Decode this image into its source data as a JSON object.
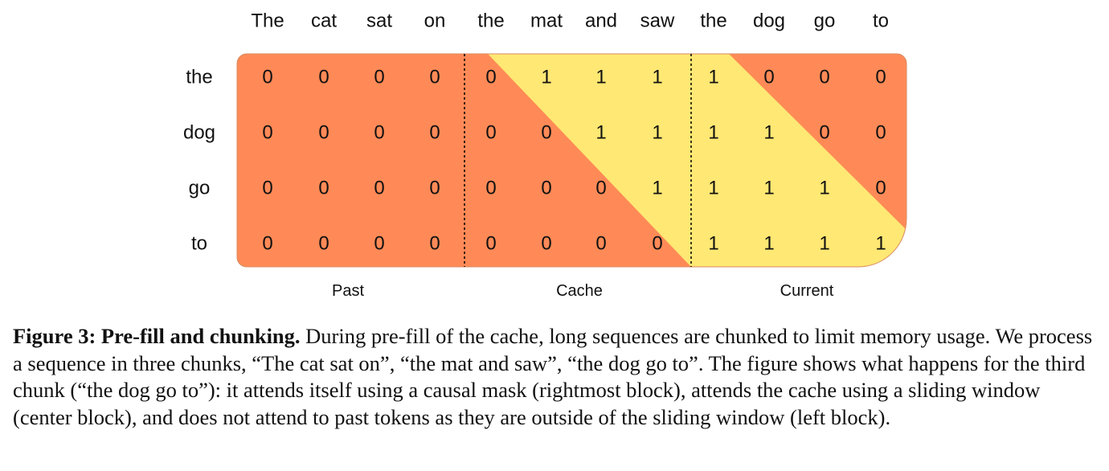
{
  "figure": {
    "columns": [
      "The",
      "cat",
      "sat",
      "on",
      "the",
      "mat",
      "and",
      "saw",
      "the",
      "dog",
      "go",
      "to"
    ],
    "rows": [
      {
        "label": "the",
        "values": [
          "0",
          "0",
          "0",
          "0",
          "0",
          "1",
          "1",
          "1",
          "1",
          "0",
          "0",
          "0"
        ]
      },
      {
        "label": "dog",
        "values": [
          "0",
          "0",
          "0",
          "0",
          "0",
          "0",
          "1",
          "1",
          "1",
          "1",
          "0",
          "0"
        ]
      },
      {
        "label": "go",
        "values": [
          "0",
          "0",
          "0",
          "0",
          "0",
          "0",
          "0",
          "1",
          "1",
          "1",
          "1",
          "0"
        ]
      },
      {
        "label": "to",
        "values": [
          "0",
          "0",
          "0",
          "0",
          "0",
          "0",
          "0",
          "0",
          "1",
          "1",
          "1",
          "1"
        ]
      }
    ],
    "blocks": [
      "Past",
      "Cache",
      "Current"
    ],
    "colors": {
      "masked": "#FF8A57",
      "attended": "#FFE873",
      "border": "#d98a60"
    }
  },
  "caption": {
    "label": "Figure 3: Pre-fill and chunking.",
    "text": " During pre-fill of the cache, long sequences are chunked to limit memory usage. We process a sequence in three chunks, “The cat sat on”, “the mat and saw”, “the dog go to”. The figure shows what happens for the third chunk (“the dog go to”): it attends itself using a causal mask (rightmost block), attends the cache using a sliding window (center block), and does not attend to past tokens as they are outside of the sliding window (left block)."
  }
}
